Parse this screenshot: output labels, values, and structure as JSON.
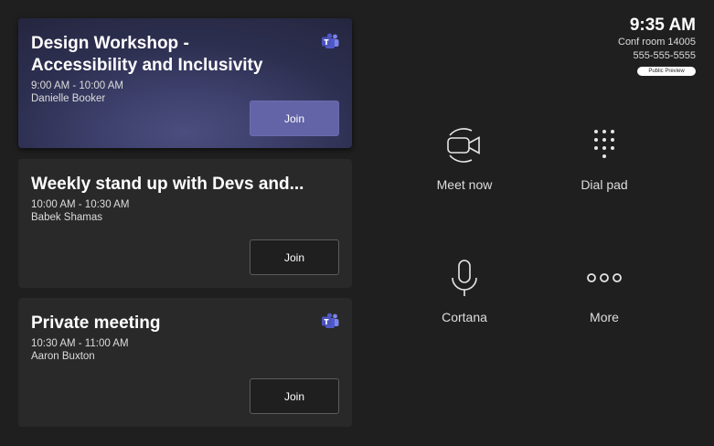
{
  "meetings": [
    {
      "title": "Design Workshop - Accessibility and Inclusivity",
      "time": "9:00 AM - 10:00 AM",
      "organizer": "Danielle Booker",
      "join_label": "Join",
      "teams_icon": "teams-icon"
    },
    {
      "title": "Weekly stand up with Devs and...",
      "time": "10:00 AM - 10:30 AM",
      "organizer": "Babek Shamas",
      "join_label": "Join"
    },
    {
      "title": "Private meeting",
      "time": "10:30 AM - 11:00 AM",
      "organizer": "Aaron Buxton",
      "join_label": "Join",
      "teams_icon": "teams-icon"
    }
  ],
  "status": {
    "time": "9:35 AM",
    "room": "Conf room 14005",
    "phone": "555-555-5555",
    "badge": "Public Preview"
  },
  "actions": [
    {
      "label": "Meet now",
      "icon": "video-camera-icon"
    },
    {
      "label": "Dial pad",
      "icon": "dial-pad-icon"
    },
    {
      "label": "Cortana",
      "icon": "microphone-icon"
    },
    {
      "label": "More",
      "icon": "more-icon"
    }
  ],
  "colors": {
    "background": "#1f1f1f",
    "card": "#292929",
    "active_card": "#3d406b",
    "join_primary": "#6264a7",
    "teams_brand": "#7b83eb"
  }
}
